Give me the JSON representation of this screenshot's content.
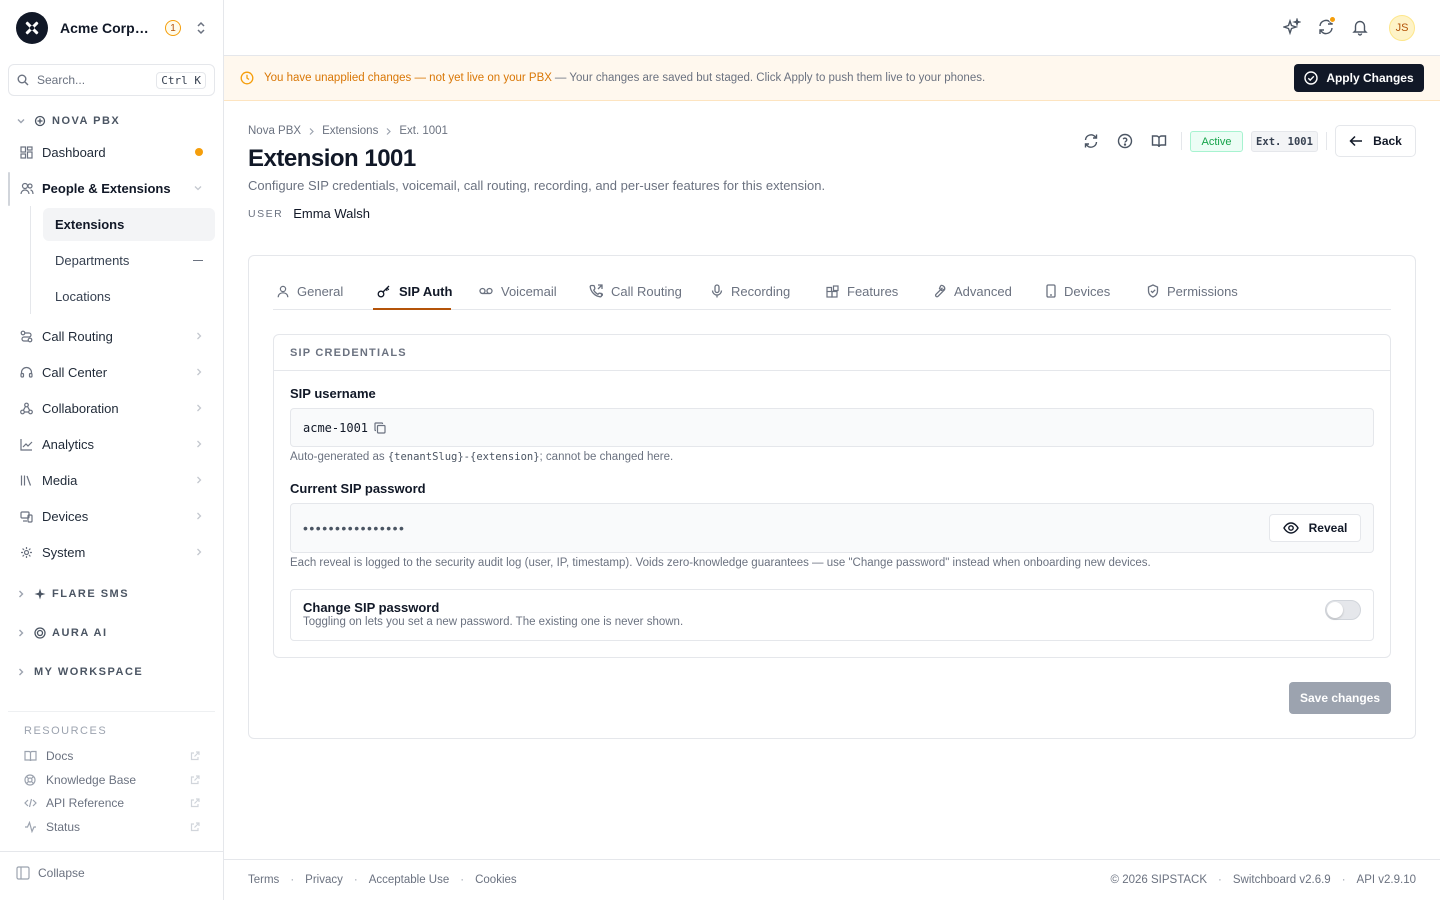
{
  "org": {
    "name": "Acme Corporation",
    "badge": "1"
  },
  "search": {
    "placeholder": "Search...",
    "shortcut": "Ctrl K"
  },
  "sidebar": {
    "sections": [
      {
        "label": "NOVA PBX"
      },
      {
        "label": "FLARE SMS"
      },
      {
        "label": "AURA AI"
      },
      {
        "label": "MY WORKSPACE"
      }
    ],
    "items": [
      {
        "label": "Dashboard"
      },
      {
        "label": "People & Extensions"
      },
      {
        "label": "Call Routing"
      },
      {
        "label": "Call Center"
      },
      {
        "label": "Collaboration"
      },
      {
        "label": "Analytics"
      },
      {
        "label": "Media"
      },
      {
        "label": "Devices"
      },
      {
        "label": "System"
      }
    ],
    "subitems": [
      {
        "label": "Extensions"
      },
      {
        "label": "Departments"
      },
      {
        "label": "Locations"
      }
    ],
    "resources_title": "RESOURCES",
    "resources": [
      {
        "label": "Docs"
      },
      {
        "label": "Knowledge Base"
      },
      {
        "label": "API Reference"
      },
      {
        "label": "Status"
      }
    ],
    "collapse": "Collapse"
  },
  "topbar": {
    "avatar": "JS"
  },
  "banner": {
    "strong": "You have unapplied changes — not yet live on your PBX",
    "rest": "— Your changes are saved but staged. Click Apply to push them live to your phones.",
    "apply": "Apply Changes"
  },
  "breadcrumb": [
    "Nova PBX",
    "Extensions",
    "Ext. 1001"
  ],
  "page": {
    "title": "Extension 1001",
    "subtitle": "Configure SIP credentials, voicemail, call routing, recording, and per-user features for this extension.",
    "user_label": "USER",
    "user_value": "Emma Walsh",
    "status": "Active",
    "ext_badge": "Ext. 1001",
    "back": "Back"
  },
  "tabs": [
    {
      "label": "General"
    },
    {
      "label": "SIP Auth"
    },
    {
      "label": "Voicemail"
    },
    {
      "label": "Call Routing"
    },
    {
      "label": "Recording"
    },
    {
      "label": "Features"
    },
    {
      "label": "Advanced"
    },
    {
      "label": "Devices"
    },
    {
      "label": "Permissions"
    }
  ],
  "sip": {
    "section_title": "SIP CREDENTIALS",
    "username_label": "SIP username",
    "username_value": "acme-1001",
    "username_help_pre": "Auto-generated as",
    "username_help_code": "{tenantSlug}-{extension}",
    "username_help_post": "; cannot be changed here.",
    "password_label": "Current SIP password",
    "password_value": "••••••••••••••••",
    "reveal": "Reveal",
    "password_help": "Each reveal is logged to the security audit log (user, IP, timestamp). Voids zero-knowledge guarantees — use \"Change password\" instead when onboarding new devices.",
    "change_title": "Change SIP password",
    "change_desc": "Toggling on lets you set a new password. The existing one is never shown."
  },
  "save": "Save changes",
  "footer": {
    "links": [
      "Terms",
      "Privacy",
      "Acceptable Use",
      "Cookies"
    ],
    "copyright": "© 2026 SIPSTACK",
    "version": "Switchboard v2.6.9",
    "api": "API v2.9.10"
  }
}
